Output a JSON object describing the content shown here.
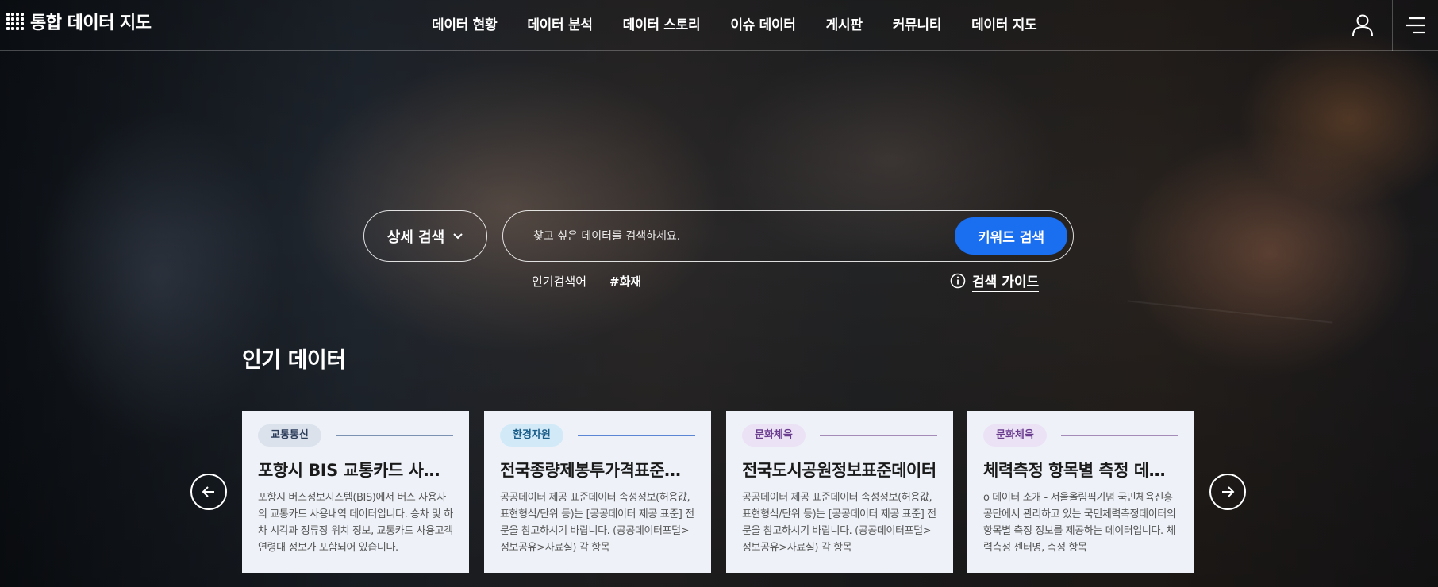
{
  "header": {
    "logo_text": "통합 데이터 지도",
    "nav": [
      {
        "label": "데이터 현황"
      },
      {
        "label": "데이터 분석"
      },
      {
        "label": "데이터 스토리"
      },
      {
        "label": "이슈 데이터"
      },
      {
        "label": "게시판"
      },
      {
        "label": "커뮤니티"
      },
      {
        "label": "데이터 지도"
      }
    ],
    "icons": {
      "user": "user-icon",
      "menu": "hamburger-menu-icon"
    }
  },
  "search": {
    "detail_label": "상세 검색",
    "placeholder": "찾고 싶은 데이터를 검색하세요.",
    "value": "",
    "button_label": "키워드 검색",
    "popular_label": "인기검색어",
    "popular_tags": [
      "#화재"
    ],
    "guide_label": "검색 가이드"
  },
  "popular": {
    "title": "인기 데이터",
    "cards": [
      {
        "category": "교통통신",
        "chip_bg": "#dbe2ec",
        "chip_color": "#2c3e5a",
        "line_color": "#7c92b3",
        "title": "포항시 BIS 교통카드 사용내역",
        "desc": "포항시 버스정보시스템(BIS)에서 버스 사용자의 교통카드 사용내역 데이터입니다. 승차 및 하차 시각과 정류장 위치 정보, 교통카드 사용고객 연령대 정보가 포함되어 있습니다."
      },
      {
        "category": "환경자원",
        "chip_bg": "#d2eaf8",
        "chip_color": "#1b5e8a",
        "line_color": "#5b86d6",
        "title": "전국종량제봉투가격표준데이터",
        "desc": "공공데이터 제공 표준데이터 속성정보(허용값, 표현형식/단위 등)는 [공공데이터 제공 표준] 전문을 참고하시기 바랍니다. (공공데이터포털>정보공유>자료실) 각 항목"
      },
      {
        "category": "문화체육",
        "chip_bg": "#ece2f6",
        "chip_color": "#6a3d8f",
        "line_color": "#a48bb8",
        "title": "전국도시공원정보표준데이터",
        "desc": "공공데이터 제공 표준데이터 속성정보(허용값, 표현형식/단위 등)는 [공공데이터 제공 표준] 전문을 참고하시기 바랍니다. (공공데이터포털>정보공유>자료실) 각 항목"
      },
      {
        "category": "문화체육",
        "chip_bg": "#ece2f6",
        "chip_color": "#6a3d8f",
        "line_color": "#a48bb8",
        "title": "체력측정 항목별 측정 데이터",
        "desc": "o 데이터 소개 - 서울올림픽기념 국민체육진흥공단에서 관리하고 있는 국민체력측정데이터의 항목별 측정 정보를 제공하는 데이터입니다. 체력측정 센터명, 측정 항목"
      }
    ]
  }
}
